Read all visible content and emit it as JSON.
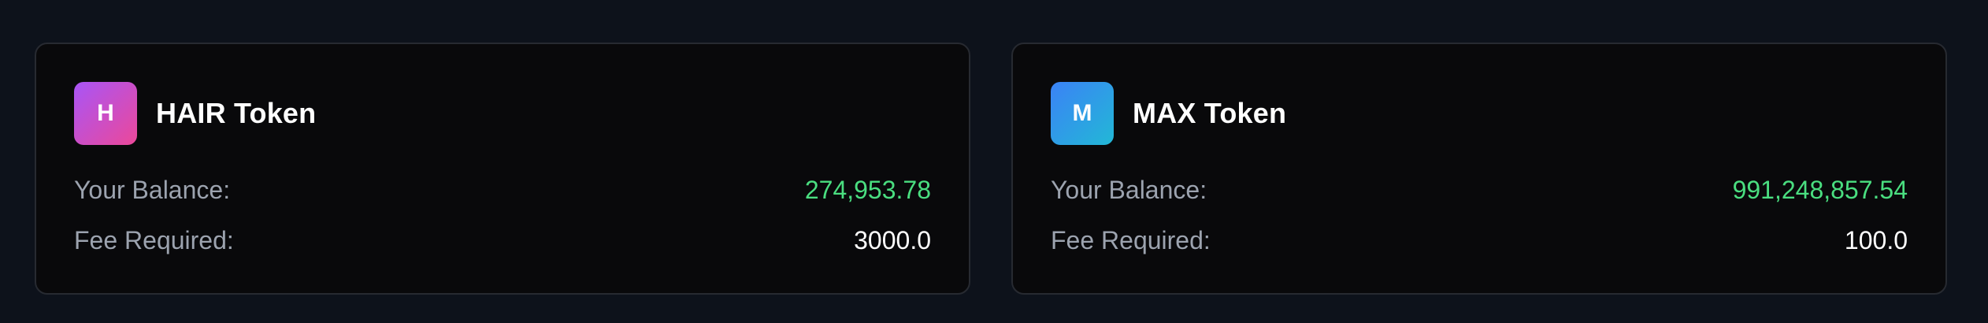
{
  "tokens": [
    {
      "icon_letter": "H",
      "name": "HAIR Token",
      "balance_label": "Your Balance:",
      "balance_value": "274,953.78",
      "fee_label": "Fee Required:",
      "fee_value": "3000.0",
      "icon_gradient": [
        "#a855f7",
        "#ec4899"
      ]
    },
    {
      "icon_letter": "M",
      "name": "MAX Token",
      "balance_label": "Your Balance:",
      "balance_value": "991,248,857.54",
      "fee_label": "Fee Required:",
      "fee_value": "100.0",
      "icon_gradient": [
        "#3b82f6",
        "#22b8d6"
      ]
    }
  ],
  "colors": {
    "page_background": "#0d121b",
    "card_background": "#09090b",
    "card_border": "#272a31",
    "balance_value": "#4ade80",
    "label": "#9ca3af",
    "text_primary": "#ffffff"
  }
}
